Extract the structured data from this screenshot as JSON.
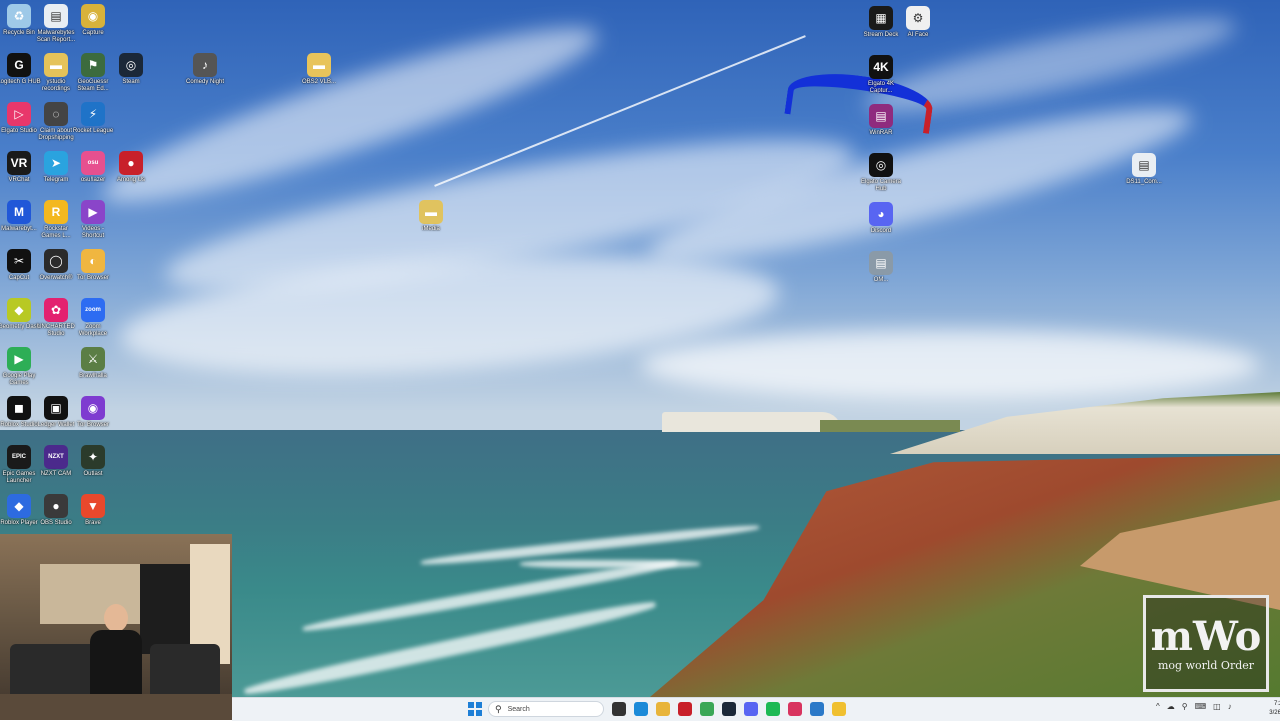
{
  "desktop_icons": [
    {
      "label": "Recycle Bin",
      "glyph": "♻",
      "color": "#9ec9e8",
      "icon": "recycle-bin-icon"
    },
    {
      "label": "Malwarebytes Scan Report...",
      "glyph": "▤",
      "color": "#e9eef3",
      "icon": "document-icon"
    },
    {
      "label": "Capture",
      "glyph": "◉",
      "color": "#d8b23a",
      "icon": "capture-icon"
    },
    {
      "label": "Logitech G HUB",
      "glyph": "G",
      "color": "#111111",
      "icon": "logitech-icon"
    },
    {
      "label": "ystudio recordings",
      "glyph": "▬",
      "color": "#e5c35a",
      "icon": "folder-icon"
    },
    {
      "label": "GeoGuessr Steam Ed...",
      "glyph": "⚑",
      "color": "#3c6b3e",
      "icon": "geoguessr-icon"
    },
    {
      "label": "Steam",
      "glyph": "◎",
      "color": "#1b2838",
      "icon": "steam-icon"
    },
    {
      "label": "Comedy Night",
      "glyph": "♪",
      "color": "#555555",
      "icon": "microphone-icon"
    },
    {
      "label": "OBS2 VLB...",
      "glyph": "▬",
      "color": "#e8c45b",
      "icon": "folder-icon"
    },
    {
      "label": "Elgato Studio",
      "glyph": "▷",
      "color": "#e8376b",
      "icon": "elgato-studio-icon"
    },
    {
      "label": "Claim about Dropshipping",
      "glyph": "◌",
      "color": "#444444",
      "icon": "app-icon"
    },
    {
      "label": "Rocket League",
      "glyph": "⚡",
      "color": "#1f73c8",
      "icon": "rocket-league-icon"
    },
    {
      "label": "VRChat",
      "glyph": "VR",
      "color": "#1a1a1a",
      "icon": "vrchat-icon"
    },
    {
      "label": "Telegram",
      "glyph": "➤",
      "color": "#2aa3df",
      "icon": "telegram-icon"
    },
    {
      "label": "osu!lazer",
      "glyph": "osu",
      "color": "#e7508f",
      "icon": "osu-icon"
    },
    {
      "label": "Among Us",
      "glyph": "●",
      "color": "#c8202a",
      "icon": "among-us-icon"
    },
    {
      "label": "Malwarebyt...",
      "glyph": "M",
      "color": "#2057d8",
      "icon": "malwarebytes-icon"
    },
    {
      "label": "Rockstar Games L...",
      "glyph": "R",
      "color": "#f3b81f",
      "icon": "rockstar-icon"
    },
    {
      "label": "Videos - Shortcut",
      "glyph": "▶",
      "color": "#8a45c9",
      "icon": "videos-icon"
    },
    {
      "label": "iMedia",
      "glyph": "▬",
      "color": "#e0c35f",
      "icon": "folder-icon"
    },
    {
      "label": "CapCut",
      "glyph": "✂",
      "color": "#111111",
      "icon": "capcut-icon"
    },
    {
      "label": "Overwatch®",
      "glyph": "◯",
      "color": "#2b2b2b",
      "icon": "overwatch-icon"
    },
    {
      "label": "Tor Browser",
      "glyph": "◐",
      "color": "#f0b640",
      "icon": "tor-icon"
    },
    {
      "label": "Geometry Dash",
      "glyph": "◆",
      "color": "#b8c924",
      "icon": "geometry-dash-icon"
    },
    {
      "label": "UNCHARTED Studio",
      "glyph": "✿",
      "color": "#e3216f",
      "icon": "uncharted-icon"
    },
    {
      "label": "Zoom Workplace",
      "glyph": "zoom",
      "color": "#2d6cf2",
      "icon": "zoom-icon"
    },
    {
      "label": "Google Play Games",
      "glyph": "▶",
      "color": "#2dae56",
      "icon": "google-play-icon"
    },
    {
      "label": "Brawlhalla",
      "glyph": "⚔",
      "color": "#5b7e45",
      "icon": "brawlhalla-icon"
    },
    {
      "label": "Roblox Studio",
      "glyph": "◼",
      "color": "#111111",
      "icon": "roblox-studio-icon"
    },
    {
      "label": "Ledger Wallet",
      "glyph": "▣",
      "color": "#111111",
      "icon": "ledger-icon"
    },
    {
      "label": "Tor Browser",
      "glyph": "◉",
      "color": "#7e3bd0",
      "icon": "tor-browser-icon"
    },
    {
      "label": "Epic Games Launcher",
      "glyph": "EPIC",
      "color": "#1a1a1a",
      "icon": "epic-games-icon"
    },
    {
      "label": "NZXT CAM",
      "glyph": "NZXT",
      "color": "#4b2a8c",
      "icon": "nzxt-icon"
    },
    {
      "label": "Outlast",
      "glyph": "✦",
      "color": "#2b3b2b",
      "icon": "outlast-icon"
    },
    {
      "label": "Roblox Player",
      "glyph": "◆",
      "color": "#2d6be0",
      "icon": "roblox-icon"
    },
    {
      "label": "OBS Studio",
      "glyph": "●",
      "color": "#3a3a3a",
      "icon": "obs-icon"
    },
    {
      "label": "Brave",
      "glyph": "▼",
      "color": "#e8482c",
      "icon": "brave-icon"
    },
    {
      "label": "Stream Deck",
      "glyph": "▦",
      "color": "#1a1a1a",
      "icon": "stream-deck-icon"
    },
    {
      "label": "AI Face",
      "glyph": "⚙",
      "color": "#f0f0f0",
      "icon": "ai-face-icon"
    },
    {
      "label": "Elgato 4K Captur...",
      "glyph": "4K",
      "color": "#111111",
      "icon": "elgato-4k-icon"
    },
    {
      "label": "WinRAR",
      "glyph": "▤",
      "color": "#8f2b7e",
      "icon": "winrar-icon"
    },
    {
      "label": "Elgato Camera Hub",
      "glyph": "◎",
      "color": "#111111",
      "icon": "camera-hub-icon"
    },
    {
      "label": "Discord",
      "glyph": "◕",
      "color": "#5865f2",
      "icon": "discord-icon"
    },
    {
      "label": "OM...",
      "glyph": "▤",
      "color": "#8a9aa8",
      "icon": "app-icon"
    },
    {
      "label": "DS11_Com...",
      "glyph": "▤",
      "color": "#e9eef3",
      "icon": "document-icon"
    }
  ],
  "logo": {
    "main": "mWo",
    "sub": "mog world Order"
  },
  "taskbar": {
    "search_placeholder": "Search",
    "pinned": [
      {
        "name": "taskview",
        "color": "#333333"
      },
      {
        "name": "edge",
        "color": "#1b8ad8"
      },
      {
        "name": "files",
        "color": "#e8b43a"
      },
      {
        "name": "media",
        "color": "#c8202a"
      },
      {
        "name": "chrome",
        "color": "#3aa757"
      },
      {
        "name": "steam",
        "color": "#1b2838"
      },
      {
        "name": "discord",
        "color": "#5865f2"
      },
      {
        "name": "spotify",
        "color": "#1db954"
      },
      {
        "name": "browser",
        "color": "#d8345f"
      },
      {
        "name": "files2",
        "color": "#2b79c8"
      },
      {
        "name": "app",
        "color": "#f0c030"
      }
    ],
    "tray_icons": [
      "^",
      "☁",
      "⚲",
      "⌨",
      "◫",
      "♪"
    ],
    "time": "7:28 AM",
    "date": "3/26/2026"
  }
}
